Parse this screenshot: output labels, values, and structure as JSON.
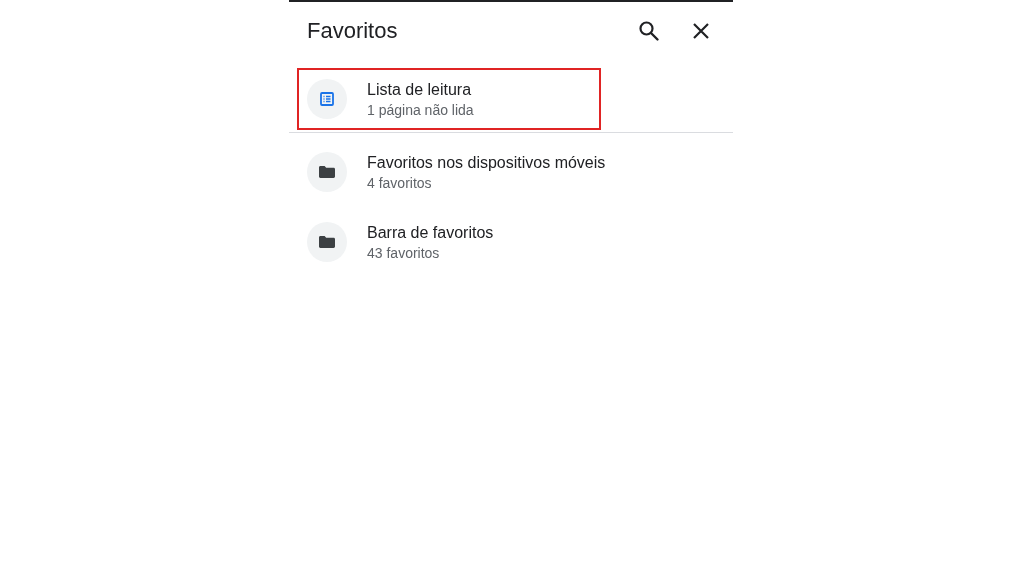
{
  "header": {
    "title": "Favoritos"
  },
  "items": [
    {
      "kind": "reading-list",
      "title": "Lista de leitura",
      "subtitle": "1 página não lida",
      "highlighted": true,
      "divider_after": true
    },
    {
      "kind": "folder",
      "title": "Favoritos nos dispositivos móveis",
      "subtitle": "4 favoritos",
      "highlighted": false,
      "divider_after": false
    },
    {
      "kind": "folder",
      "title": "Barra de favoritos",
      "subtitle": "43 favoritos",
      "highlighted": false,
      "divider_after": false
    }
  ]
}
